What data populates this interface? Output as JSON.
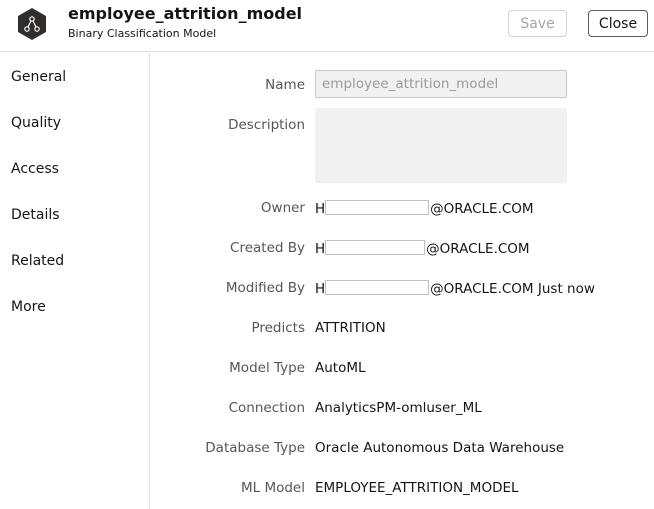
{
  "header": {
    "title": "employee_attrition_model",
    "subtitle": "Binary Classification Model",
    "save_label": "Save",
    "close_label": "Close",
    "icon": "ml-model-icon"
  },
  "sidebar": {
    "items": [
      {
        "label": "General"
      },
      {
        "label": "Quality"
      },
      {
        "label": "Access"
      },
      {
        "label": "Details"
      },
      {
        "label": "Related"
      },
      {
        "label": "More"
      }
    ]
  },
  "form": {
    "name_label": "Name",
    "name_value": "employee_attrition_model",
    "description_label": "Description",
    "description_value": "",
    "owner_label": "Owner",
    "owner_prefix": "H",
    "owner_suffix": "@ORACLE.COM",
    "created_by_label": "Created By",
    "created_by_prefix": "H",
    "created_by_suffix": "@ORACLE.COM",
    "modified_by_label": "Modified By",
    "modified_by_prefix": "H",
    "modified_by_suffix": "@ORACLE.COM Just now",
    "predicts_label": "Predicts",
    "predicts_value": "ATTRITION",
    "model_type_label": "Model Type",
    "model_type_value": "AutoML",
    "connection_label": "Connection",
    "connection_value": "AnalyticsPM-omluser_ML",
    "database_type_label": "Database Type",
    "database_type_value": "Oracle Autonomous Data Warehouse",
    "ml_model_label": "ML Model",
    "ml_model_value": "EMPLOYEE_ATTRITION_MODEL"
  },
  "colors": {
    "icon_bg": "#312d2a",
    "border": "#e2e2e2",
    "input_bg": "#f1f1f1"
  }
}
